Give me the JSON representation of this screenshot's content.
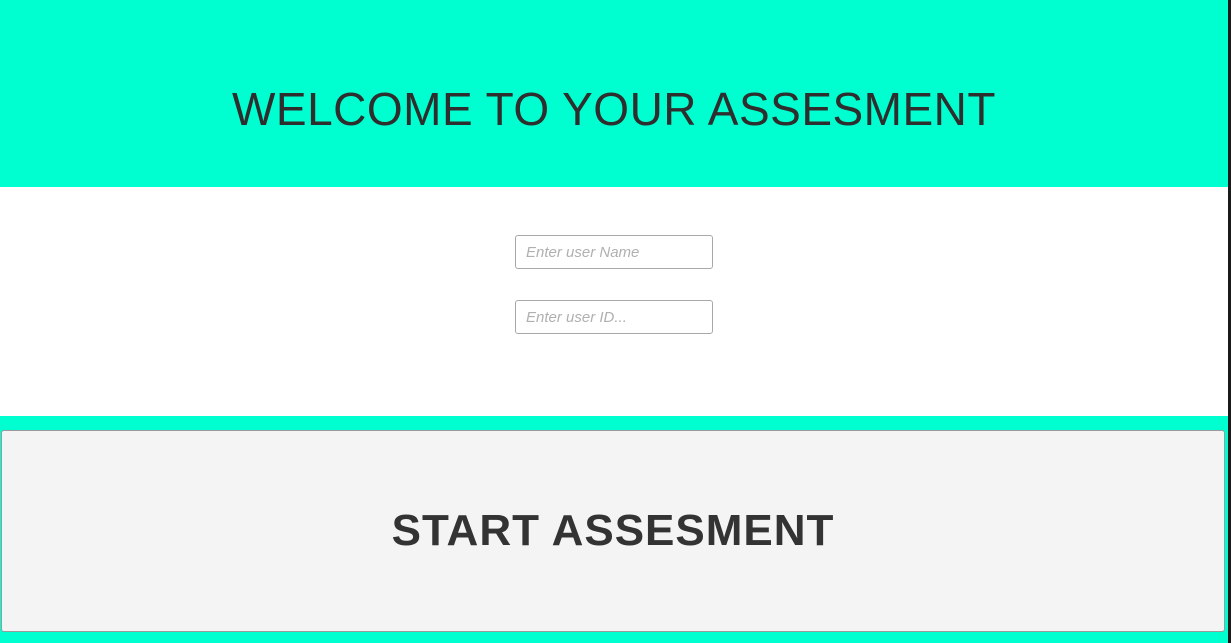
{
  "header": {
    "title": "WELCOME TO YOUR ASSESMENT"
  },
  "form": {
    "username": {
      "value": "",
      "placeholder": "Enter user Name"
    },
    "userid": {
      "value": "",
      "placeholder": "Enter user ID..."
    }
  },
  "footer": {
    "start_label": "START ASSESMENT"
  },
  "colors": {
    "accent": "#00ffd0",
    "button_bg": "#f4f4f4",
    "text": "#2e2e2e"
  }
}
